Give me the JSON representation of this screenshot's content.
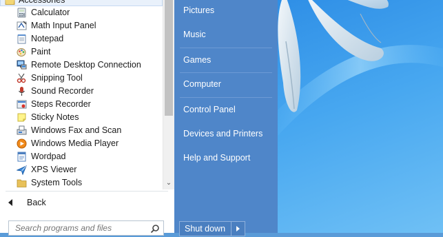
{
  "programs": {
    "folder": {
      "label": "Accessories",
      "icon": "folder-open-icon"
    },
    "items": [
      {
        "label": "Calculator",
        "icon": "calculator-icon"
      },
      {
        "label": "Math Input Panel",
        "icon": "math-input-icon"
      },
      {
        "label": "Notepad",
        "icon": "notepad-icon"
      },
      {
        "label": "Paint",
        "icon": "paint-icon"
      },
      {
        "label": "Remote Desktop Connection",
        "icon": "remote-desktop-icon"
      },
      {
        "label": "Snipping Tool",
        "icon": "scissors-icon"
      },
      {
        "label": "Sound Recorder",
        "icon": "microphone-icon"
      },
      {
        "label": "Steps Recorder",
        "icon": "steps-recorder-icon"
      },
      {
        "label": "Sticky Notes",
        "icon": "sticky-note-icon"
      },
      {
        "label": "Windows Fax and Scan",
        "icon": "fax-icon"
      },
      {
        "label": "Windows Media Player",
        "icon": "media-player-icon"
      },
      {
        "label": "Wordpad",
        "icon": "wordpad-icon"
      },
      {
        "label": "XPS Viewer",
        "icon": "xps-viewer-icon"
      },
      {
        "label": "System Tools",
        "icon": "folder-icon"
      }
    ]
  },
  "back": {
    "label": "Back"
  },
  "search": {
    "placeholder": "Search programs and files"
  },
  "right_menu": {
    "items": [
      "Pictures",
      "Music",
      "Games",
      "Computer",
      "Control Panel",
      "Devices and Printers",
      "Help and Support"
    ]
  },
  "shutdown": {
    "label": "Shut down"
  },
  "colors": {
    "right_pane": "#4f86c9",
    "left_pane": "#ffffff",
    "wallpaper": "#47a7f0"
  }
}
